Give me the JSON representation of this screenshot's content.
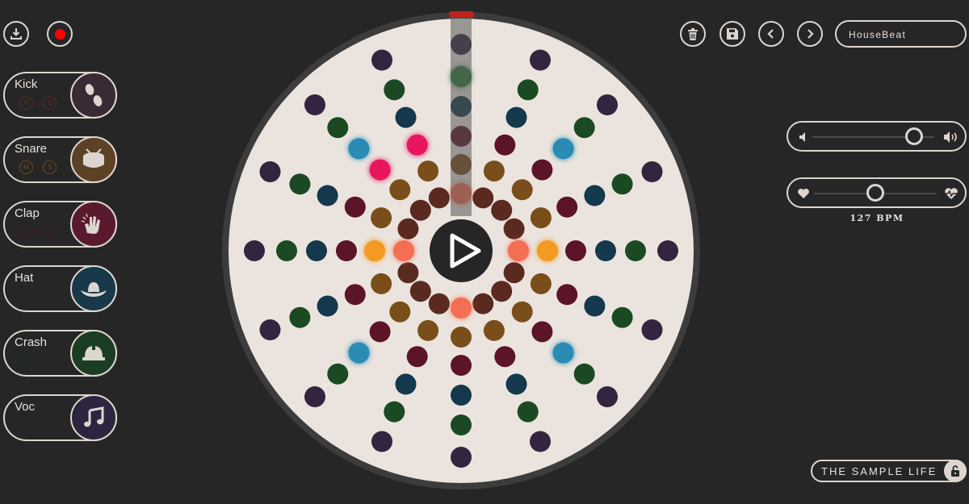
{
  "toolbar": {
    "download_icon": "download-icon",
    "record_icon": "record-icon",
    "record_color": "#ff0000",
    "delete_icon": "trash-icon",
    "save_icon": "save-icon",
    "prev_icon": "chevron-left-icon",
    "next_icon": "chevron-right-icon",
    "preset_name": "HouseBeat"
  },
  "instruments": [
    {
      "label": "Kick",
      "icon": "footsteps-icon",
      "color": "#3a2a34",
      "ring": "#5a2a20"
    },
    {
      "label": "Snare",
      "icon": "drum-icon",
      "color": "#5c4124",
      "ring": "#6b4b1e"
    },
    {
      "label": "Clap",
      "icon": "clap-icon",
      "color": "#5a1a2e",
      "ring": "#4a1a22"
    },
    {
      "label": "Hat",
      "icon": "hat-icon",
      "color": "#17394a",
      "ring": "#1c2e36"
    },
    {
      "label": "Crash",
      "icon": "helmet-icon",
      "color": "#1a3d24",
      "ring": "#1d3322"
    },
    {
      "label": "Voc",
      "icon": "music-note-icon",
      "color": "#2e2440",
      "ring": "#2a2436"
    }
  ],
  "mute_label": "M",
  "solo_label": "S",
  "volume": {
    "level": 0.84,
    "low_icon": "volume-low-icon",
    "high_icon": "volume-high-icon"
  },
  "tempo": {
    "value_label": "127 BPM",
    "level": 0.5,
    "low_icon": "heart-icon",
    "high_icon": "heartbeat-icon"
  },
  "play_icon": "play-icon",
  "brand": {
    "label": "THE SAMPLE LIFE",
    "lock_icon": "lock-open-icon"
  },
  "ring_colors": [
    "#5a2a20",
    "#7a4e1a",
    "#5c1428",
    "#14384c",
    "#1b4a22",
    "#35243f"
  ],
  "active_colors": {
    "kick": "#f36e52",
    "snare": "#f39a22",
    "clap": "#e8195e",
    "hat": "#2a8bb5",
    "crash": "#2f7a3a"
  },
  "steps": 16,
  "active": [
    {
      "ring": 0,
      "step": 0,
      "color": "kick"
    },
    {
      "ring": 0,
      "step": 4,
      "color": "kick"
    },
    {
      "ring": 0,
      "step": 8,
      "color": "kick"
    },
    {
      "ring": 0,
      "step": 12,
      "color": "kick"
    },
    {
      "ring": 1,
      "step": 4,
      "color": "snare"
    },
    {
      "ring": 1,
      "step": 12,
      "color": "snare"
    },
    {
      "ring": 2,
      "step": 14,
      "color": "clap"
    },
    {
      "ring": 2,
      "step": 15,
      "color": "clap"
    },
    {
      "ring": 3,
      "step": 2,
      "color": "hat"
    },
    {
      "ring": 3,
      "step": 6,
      "color": "hat"
    },
    {
      "ring": 3,
      "step": 10,
      "color": "hat"
    },
    {
      "ring": 3,
      "step": 14,
      "color": "hat"
    },
    {
      "ring": 4,
      "step": 0,
      "color": "crash"
    }
  ]
}
